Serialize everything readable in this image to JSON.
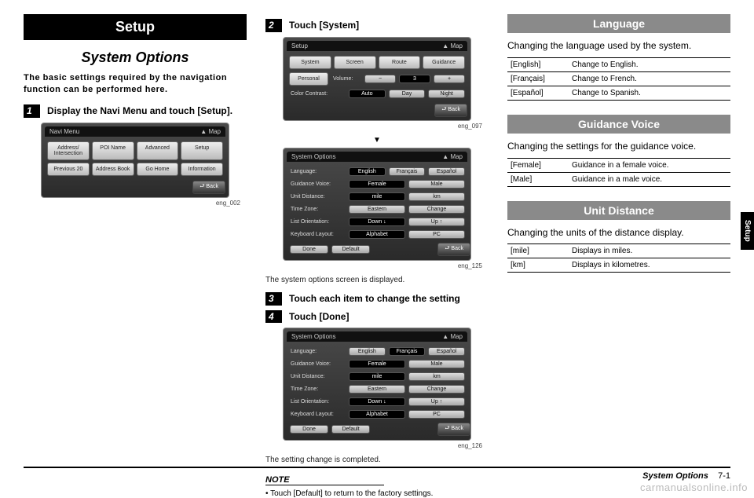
{
  "sideTab": "Setup",
  "col1": {
    "banner": "Setup",
    "title": "System Options",
    "intro": "The basic settings required by the navigation function can be performed here.",
    "step1": {
      "num": "1",
      "text": "Display the Navi Menu and touch [Setup]."
    },
    "screen1": {
      "headerLeft": "Navi Menu",
      "headerRight": "▲ Map",
      "buttons": [
        "Address/\nIntersection",
        "POI Name",
        "Advanced",
        "Setup",
        "Previous\n20",
        "Address\nBook",
        "Go Home",
        "Information"
      ],
      "back": "⮐ Back"
    },
    "fig1": "eng_002"
  },
  "col2": {
    "step2": {
      "num": "2",
      "text": "Touch [System]"
    },
    "screen2": {
      "headerLeft": "Setup",
      "headerRight": "▲ Map",
      "tabs": [
        "System",
        "Screen",
        "Route",
        "Guidance"
      ],
      "personal": "Personal",
      "volumeLabel": "Volume:",
      "volMinus": "−",
      "volVal": "3",
      "volPlus": "+",
      "contrastLabel": "Color Contrast:",
      "contrast": [
        "Auto",
        "Day",
        "Night"
      ],
      "back": "⮐ Back"
    },
    "fig2": "eng_097",
    "screen3": {
      "headerLeft": "System Options",
      "headerRight": "▲ Map",
      "rows": [
        {
          "label": "Language:",
          "opts": [
            "English",
            "Français",
            "Español"
          ],
          "sel": 0
        },
        {
          "label": "Guidance Voice:",
          "opts": [
            "Female",
            "Male"
          ],
          "sel": 0
        },
        {
          "label": "Unit Distance:",
          "opts": [
            "mile",
            "km"
          ],
          "sel": 0
        },
        {
          "label": "Time Zone:",
          "opts": [
            "Eastern",
            "Change"
          ],
          "sel": -1
        },
        {
          "label": "List Orientation:",
          "opts": [
            "Down ↓",
            "Up ↑"
          ],
          "sel": 0
        },
        {
          "label": "Keyboard Layout:",
          "opts": [
            "Alphabet",
            "PC"
          ],
          "sel": 0
        }
      ],
      "bottom": [
        "Done",
        "Default"
      ],
      "back": "⮐ Back"
    },
    "fig3": "eng_125",
    "caption3": "The system options screen is displayed.",
    "step3": {
      "num": "3",
      "text": "Touch each item to change the setting"
    },
    "step4": {
      "num": "4",
      "text": "Touch [Done]"
    },
    "screen4": {
      "headerLeft": "System Options",
      "headerRight": "▲ Map",
      "rows": [
        {
          "label": "Language:",
          "opts": [
            "English",
            "Français",
            "Español"
          ],
          "sel": 1
        },
        {
          "label": "Guidance Voice:",
          "opts": [
            "Female",
            "Male"
          ],
          "sel": 0
        },
        {
          "label": "Unit Distance:",
          "opts": [
            "mile",
            "km"
          ],
          "sel": 0
        },
        {
          "label": "Time Zone:",
          "opts": [
            "Eastern",
            "Change"
          ],
          "sel": -1
        },
        {
          "label": "List Orientation:",
          "opts": [
            "Down ↓",
            "Up ↑"
          ],
          "sel": 0
        },
        {
          "label": "Keyboard Layout:",
          "opts": [
            "Alphabet",
            "PC"
          ],
          "sel": 0
        }
      ],
      "bottom": [
        "Done",
        "Default"
      ],
      "back": "⮐ Back"
    },
    "fig4": "eng_126",
    "caption4": "The setting change is completed.",
    "noteTitle": "NOTE",
    "noteBody": "• Touch [Default] to return to the factory settings."
  },
  "col3": {
    "language": {
      "title": "Language",
      "desc": "Changing the language used by the system.",
      "rows": [
        {
          "k": "[English]",
          "v": "Change to English."
        },
        {
          "k": "[Français]",
          "v": "Change to French."
        },
        {
          "k": "[Español]",
          "v": "Change to Spanish."
        }
      ]
    },
    "guidance": {
      "title": "Guidance Voice",
      "desc": "Changing the settings for the guidance voice.",
      "rows": [
        {
          "k": "[Female]",
          "v": "Guidance in a female voice."
        },
        {
          "k": "[Male]",
          "v": "Guidance in a male voice."
        }
      ]
    },
    "unit": {
      "title": "Unit Distance",
      "desc": "Changing the units of the distance display.",
      "rows": [
        {
          "k": "[mile]",
          "v": "Displays in miles."
        },
        {
          "k": "[km]",
          "v": "Displays in kilometres."
        }
      ]
    }
  },
  "footer": {
    "section": "System Options",
    "page": "7-1"
  },
  "watermark": "carmanualsonline.info"
}
